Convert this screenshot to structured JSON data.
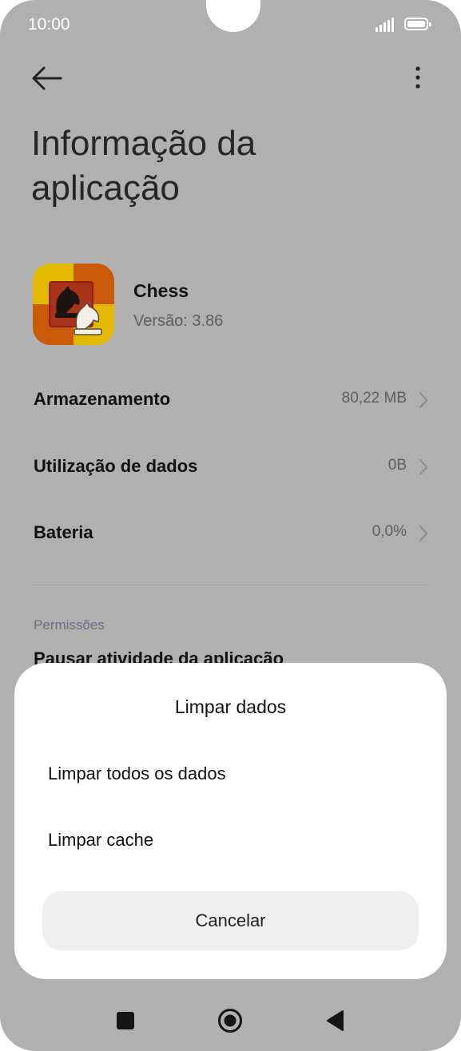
{
  "status_bar": {
    "time": "10:00"
  },
  "page": {
    "title": "Informação da\naplicação"
  },
  "app": {
    "name": "Chess",
    "version": "Versão: 3.86"
  },
  "rows": [
    {
      "label": "Armazenamento",
      "value": "80,22 MB"
    },
    {
      "label": "Utilização de dados",
      "value": "0B"
    },
    {
      "label": "Bateria",
      "value": "0,0%"
    }
  ],
  "permissions": {
    "header": "Permissões",
    "first_item": "Pausar atividade da aplicação"
  },
  "sheet": {
    "title": "Limpar dados",
    "options": [
      "Limpar todos os dados",
      "Limpar cache"
    ],
    "cancel_label": "Cancelar"
  },
  "icons": {
    "back": "arrow-left-icon",
    "more": "more-vertical-icon",
    "chevron": "chevron-right-icon",
    "nav_recents": "square-icon",
    "nav_home": "circle-icon",
    "nav_back": "triangle-back-icon"
  },
  "colors": {
    "dim_background": "#b0b0b0",
    "sheet_background": "#ffffff",
    "cancel_background": "#efefef"
  }
}
